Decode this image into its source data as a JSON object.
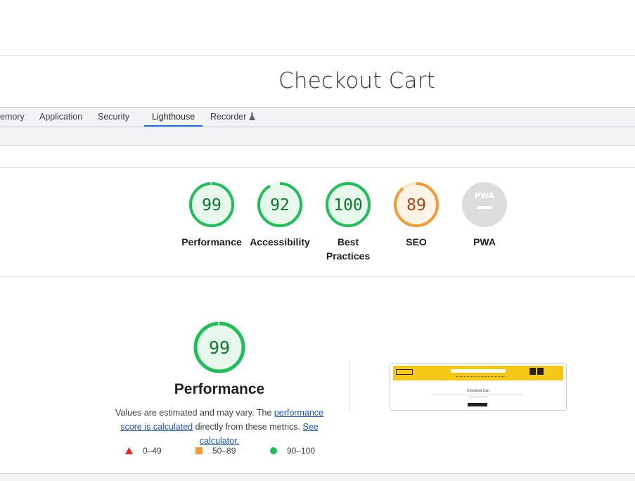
{
  "page": {
    "title": "Checkout Cart"
  },
  "devtools": {
    "tabs": [
      {
        "label": "emory"
      },
      {
        "label": "Application"
      },
      {
        "label": "Security"
      },
      {
        "label": "Lighthouse",
        "active": true
      },
      {
        "label": "Recorder"
      }
    ]
  },
  "scores": [
    {
      "label": "Performance",
      "value": "99",
      "score": 0.99,
      "status": "pass"
    },
    {
      "label": "Accessibility",
      "value": "92",
      "score": 0.92,
      "status": "pass"
    },
    {
      "label": "Best Practices",
      "label_line1": "Best",
      "label_line2": "Practices",
      "value": "100",
      "score": 1.0,
      "status": "pass"
    },
    {
      "label": "SEO",
      "value": "89",
      "score": 0.89,
      "status": "average"
    },
    {
      "label": "PWA",
      "value": "PWA",
      "status": "na"
    }
  ],
  "performance": {
    "score": "99",
    "title": "Performance",
    "desc_pre": "Values are estimated and may vary. The ",
    "desc_link1": "performance score is calculated",
    "desc_mid": " directly from these metrics. ",
    "desc_link2": "See calculator.",
    "legend": [
      {
        "shape": "triangle",
        "range": "0–49",
        "color": "#e8262b"
      },
      {
        "shape": "square",
        "range": "50–89",
        "color": "#f29c33"
      },
      {
        "shape": "circle",
        "range": "90–100",
        "color": "#1dbf57"
      }
    ]
  },
  "thumbnail": {
    "heading": "Checkout Cart"
  },
  "colors": {
    "pass": "#1dbf57",
    "pass_bg": "#e8f8ed",
    "pass_text": "#0b7a2b",
    "average": "#f29c33",
    "average_bg": "#fff4e6",
    "average_text": "#b2420b",
    "na_bg": "#dcdcdc",
    "accent": "#1a73e8"
  }
}
